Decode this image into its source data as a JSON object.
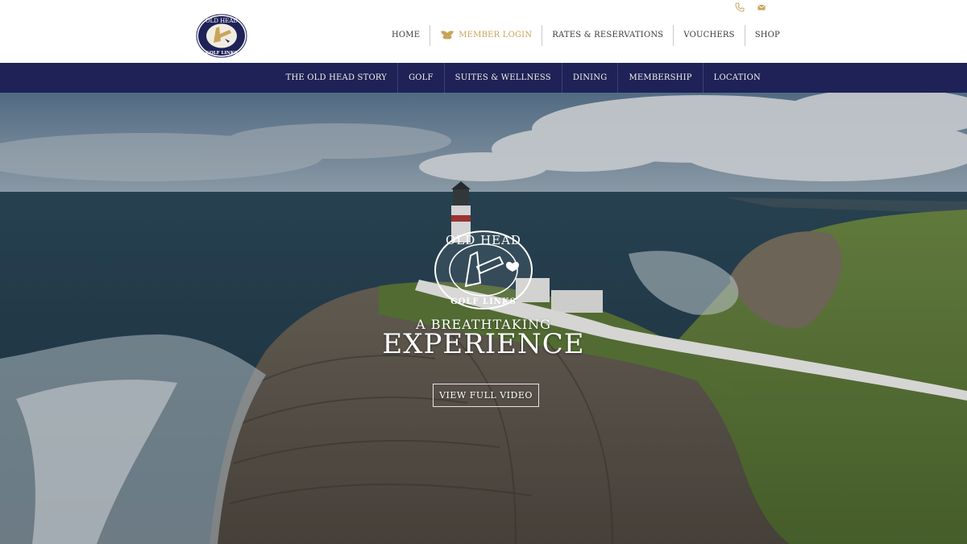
{
  "brand": {
    "logo_top_text": "OLD HEAD",
    "logo_bottom_text": "GOLF LINKS"
  },
  "utility_icons": [
    "phone-icon",
    "mail-icon"
  ],
  "top_nav": [
    {
      "label": "HOME"
    },
    {
      "label": "MEMBER LOGIN",
      "icon": "wings-icon"
    },
    {
      "label": "RATES & RESERVATIONS"
    },
    {
      "label": "VOUCHERS"
    },
    {
      "label": "SHOP"
    }
  ],
  "main_nav": [
    {
      "label": "THE OLD HEAD STORY"
    },
    {
      "label": "GOLF"
    },
    {
      "label": "SUITES & WELLNESS"
    },
    {
      "label": "DINING"
    },
    {
      "label": "MEMBERSHIP"
    },
    {
      "label": "LOCATION"
    }
  ],
  "hero": {
    "tagline_small": "A BREATHTAKING",
    "tagline_big": "EXPERIENCE",
    "button_label": "VIEW FULL VIDEO"
  },
  "colors": {
    "nav_blue": "#1e2257",
    "gold": "#c8a45a"
  }
}
